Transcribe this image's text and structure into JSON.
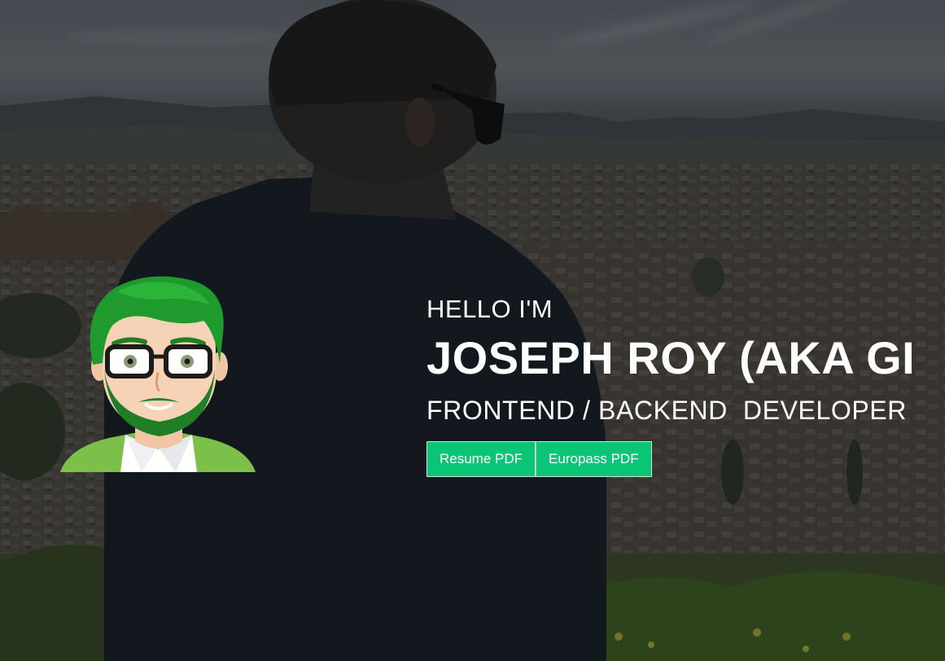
{
  "hero": {
    "greeting": "HELLO I'M",
    "name": "JOSEPH ROY (AKA GI",
    "role": "FRONTEND / BACKEND  DEVELOPER",
    "buttons": [
      {
        "label": "Resume PDF"
      },
      {
        "label": "Europass PDF"
      }
    ]
  },
  "colors": {
    "button_bg": "#0bc576",
    "text": "#ffffff",
    "avatar_hair": "#1f9a2c",
    "avatar_jacket": "#7cc04a"
  },
  "icons": {
    "avatar": "cartoon-avatar-icon"
  }
}
